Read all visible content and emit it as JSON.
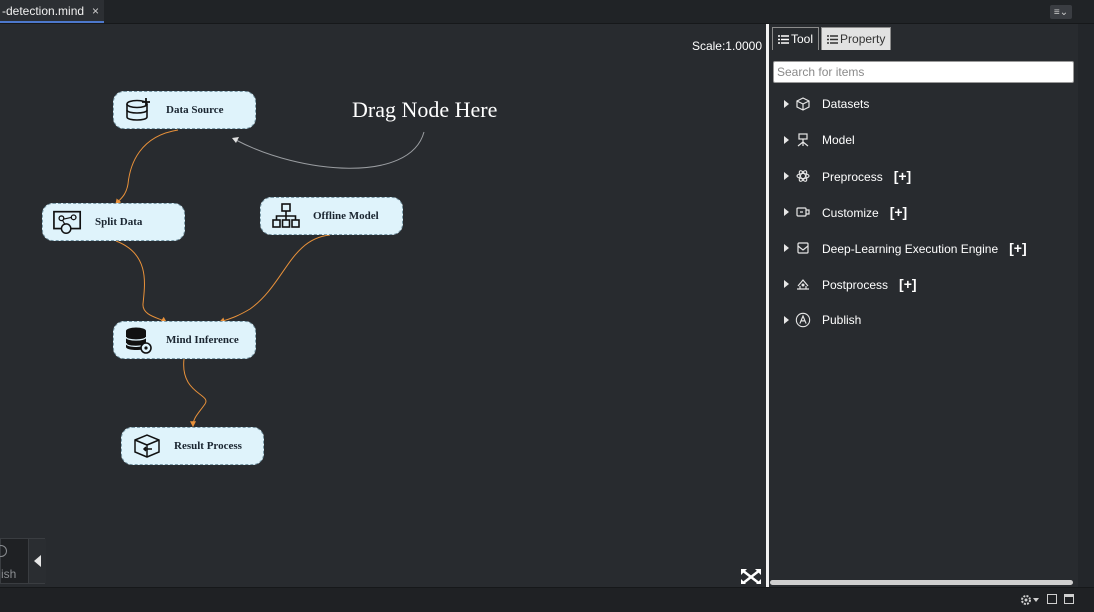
{
  "tabbar": {
    "tab_label": "-detection.mind",
    "tab_close": "×",
    "menu_icon": "≡⌄"
  },
  "canvas": {
    "scale_label": "Scale:1.0000",
    "drag_hint": "Drag Node Here",
    "edge_color": "#e8913a",
    "nodes": [
      {
        "id": "data-source",
        "label": "Data Source",
        "icon": "database-add-icon"
      },
      {
        "id": "split-data",
        "label": "Split Data",
        "icon": "split-chart-icon"
      },
      {
        "id": "offline-model",
        "label": "Offline Model",
        "icon": "hierarchy-icon"
      },
      {
        "id": "mind-inference",
        "label": "Mind Inference",
        "icon": "database-gear-icon"
      },
      {
        "id": "result-process",
        "label": "Result Process",
        "icon": "box-arrow-icon"
      }
    ],
    "bottom_left_label": "ish"
  },
  "panel": {
    "tabs": [
      {
        "label": "Tool",
        "active": true
      },
      {
        "label": "Property",
        "active": false
      }
    ],
    "search_placeholder": "Search for items",
    "items": [
      {
        "label": "Datasets",
        "icon": "cube-icon",
        "plus": ""
      },
      {
        "label": "Model",
        "icon": "model-icon",
        "plus": ""
      },
      {
        "label": "Preprocess",
        "icon": "atom-icon",
        "plus": "[+]"
      },
      {
        "label": "Customize",
        "icon": "customize-icon",
        "plus": "[+]"
      },
      {
        "label": "Deep-Learning Execution Engine",
        "icon": "engine-icon",
        "plus": "[+]"
      },
      {
        "label": "Postprocess",
        "icon": "postprocess-icon",
        "plus": "[+]"
      },
      {
        "label": "Publish",
        "icon": "publish-icon",
        "plus": ""
      }
    ]
  },
  "statusbar": {
    "gear_icon": "gear-icon"
  }
}
